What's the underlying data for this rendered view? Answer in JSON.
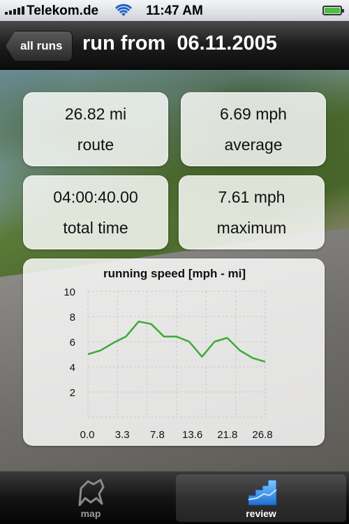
{
  "status_bar": {
    "carrier": "Telekom.de",
    "time": "11:47 AM"
  },
  "nav": {
    "back_label": "all runs",
    "title": "run from  06.11.2005"
  },
  "stats": {
    "route": {
      "value": "26.82 mi",
      "label": "route"
    },
    "average": {
      "value": "6.69 mph",
      "label": "average"
    },
    "total_time": {
      "value": "04:00:40.00",
      "label": "total time"
    },
    "maximum": {
      "value": "7.61 mph",
      "label": "maximum"
    }
  },
  "chart_data": {
    "type": "line",
    "title": "running speed [mph - mi]",
    "xlabel": "",
    "ylabel": "",
    "x_tick_labels": [
      "0.0",
      "3.3",
      "7.8",
      "13.6",
      "21.8",
      "26.8"
    ],
    "y_ticks": [
      2,
      4,
      6,
      8,
      10
    ],
    "ylim": [
      0,
      10
    ],
    "grid": true,
    "color": "#3aaa35",
    "series": [
      {
        "values": [
          5.0,
          5.3,
          5.9,
          6.4,
          7.6,
          7.4,
          6.4,
          6.4,
          6.0,
          4.8,
          6.0,
          6.3,
          5.3,
          4.7,
          4.4
        ]
      }
    ]
  },
  "tabs": [
    {
      "label": "map",
      "icon": "map-icon",
      "active": false
    },
    {
      "label": "review",
      "icon": "review-icon",
      "active": true
    }
  ],
  "colors": {
    "accent_blue": "#1e8fe0",
    "chart_line": "#3aaa35",
    "battery": "#4bbf3f"
  }
}
